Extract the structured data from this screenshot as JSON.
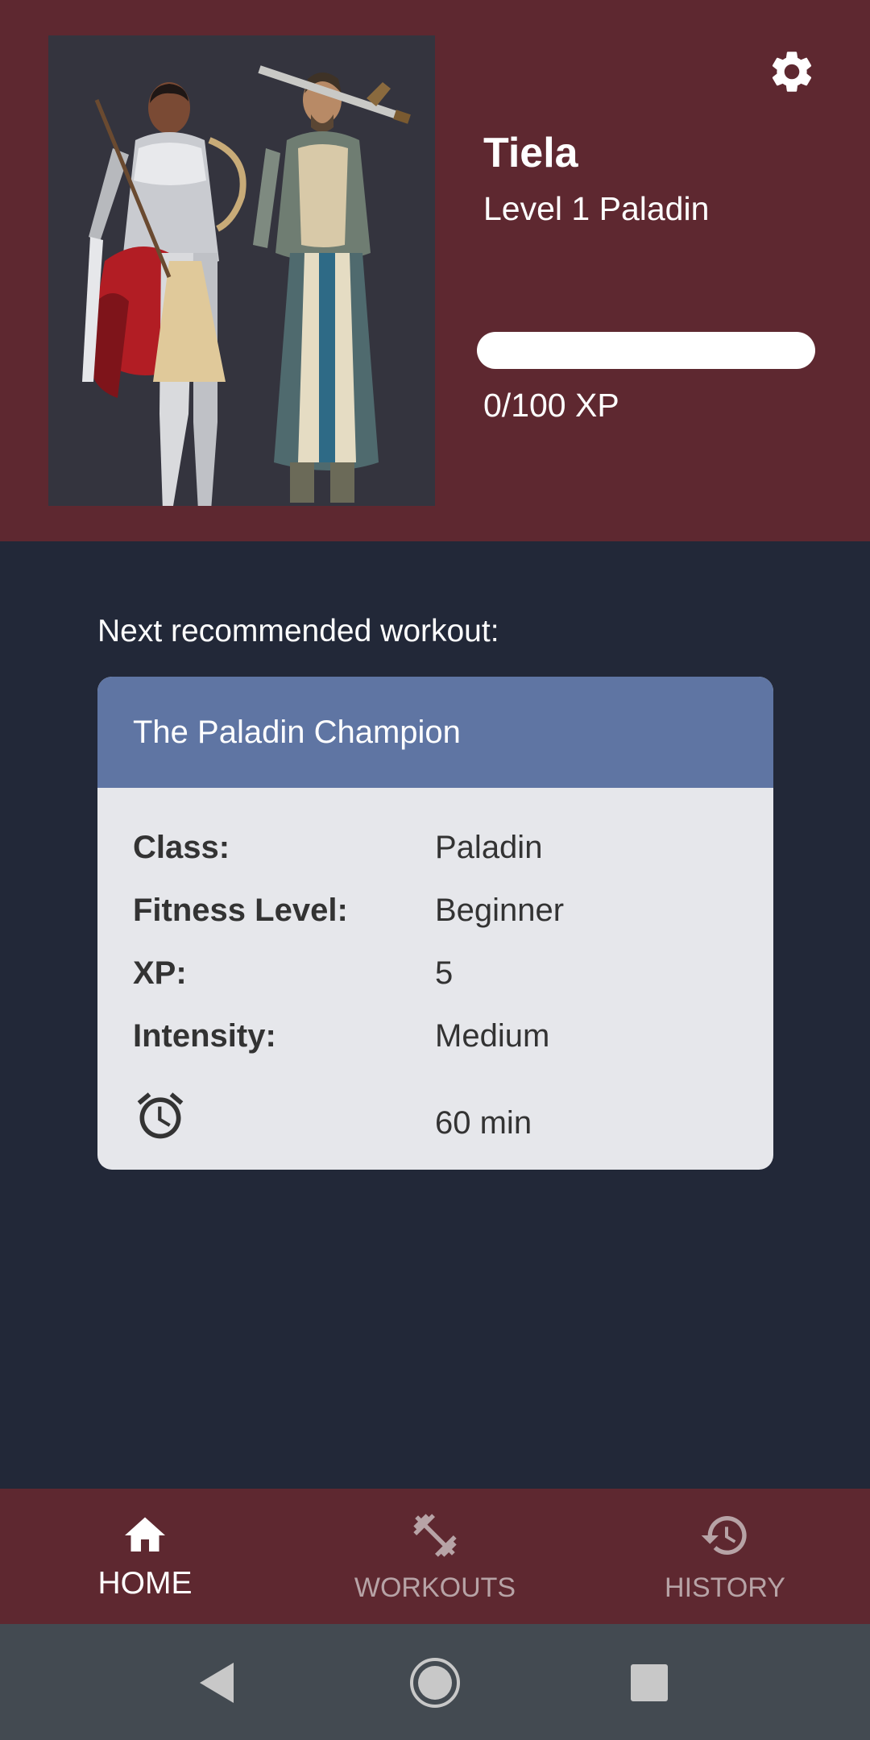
{
  "profile": {
    "name": "Tiela",
    "level_line": "Level 1 Paladin",
    "xp_text": "0/100 XP",
    "xp_current": 0,
    "xp_max": 100,
    "portrait_icon": "paladin-portrait",
    "settings_icon": "gear-icon"
  },
  "main": {
    "next_label": "Next recommended workout:"
  },
  "workout": {
    "title": "The Paladin Champion",
    "rows": [
      {
        "label": "Class:",
        "value": "Paladin"
      },
      {
        "label": "Fitness Level:",
        "value": "Beginner"
      },
      {
        "label": "XP:",
        "value": "5"
      },
      {
        "label": "Intensity:",
        "value": "Medium"
      }
    ],
    "duration_icon": "alarm-clock-icon",
    "duration": "60 min"
  },
  "bottom_nav": {
    "items": [
      {
        "label": "HOME",
        "icon": "home-icon",
        "active": true
      },
      {
        "label": "WORKOUTS",
        "icon": "dumbbell-icon",
        "active": false
      },
      {
        "label": "HISTORY",
        "icon": "history-icon",
        "active": false
      }
    ]
  },
  "system_nav": {
    "back_icon": "back-triangle-icon",
    "home_icon": "home-circle-icon",
    "recents_icon": "recents-square-icon"
  },
  "colors": {
    "header_bg": "#5e2830",
    "main_bg": "#222838",
    "card_head": "#5f75a3",
    "card_body": "#e6e7eb",
    "system_bar": "#434a51"
  }
}
